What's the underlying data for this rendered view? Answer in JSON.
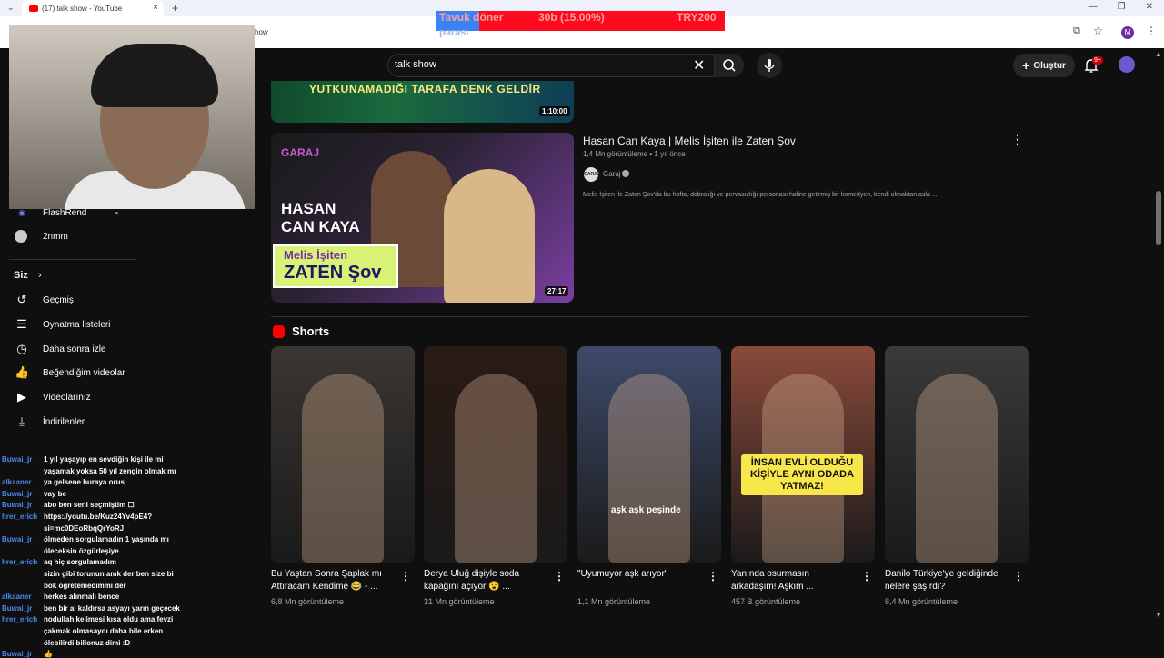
{
  "browser": {
    "tab_title": "(17) talk show - YouTube",
    "url_fragment": "how",
    "avatar_letter": "M"
  },
  "alert": {
    "left_text": "Tavuk döner",
    "middle_text": "30b (15.00%)",
    "right_text": "TRY200",
    "bottom_text": "parası"
  },
  "header": {
    "search_value": "talk show",
    "create_label": "Oluştur",
    "notifications_badge": "9+"
  },
  "sidebar": {
    "subs": [
      {
        "label": "FlashRend",
        "icon": "channel-avatar"
      },
      {
        "label": "2nmm",
        "icon": "channel-avatar"
      }
    ],
    "section_title": "Siz",
    "section_chevron": "›",
    "items": [
      {
        "label": "Geçmiş",
        "icon": "history-icon"
      },
      {
        "label": "Oynatma listeleri",
        "icon": "playlist-icon"
      },
      {
        "label": "Daha sonra izle",
        "icon": "clock-icon"
      },
      {
        "label": "Beğendiğim videolar",
        "icon": "thumbs-up-icon"
      },
      {
        "label": "Videolarınız",
        "icon": "video-icon"
      },
      {
        "label": "İndirilenler",
        "icon": "download-icon"
      }
    ]
  },
  "videos": {
    "top": {
      "thumb_text": "YUTKUNAMADIĞI TARAFA DENK GELDİR",
      "duration": "1:10:00"
    },
    "main": {
      "title": "Hasan Can Kaya | Melis İşiten ile Zaten Şov",
      "meta": "1,4 Mn görüntüleme • 1 yıl önce",
      "channel": "Garaj",
      "channel_avatar_text": "GARAJ",
      "description": "Melis İşiten ile Zaten Şov'da bu hafta, dobralığı ve pervasızlığı personası haline getirmiş bir komedyen, kendi olmaktan asla ...",
      "duration": "27:17",
      "thumb_logo": "GARAJ",
      "thumb_name_1": "HASAN",
      "thumb_name_2": "CAN KAYA",
      "thumb_show_1": "Melis İşiten",
      "thumb_show_2": "ZATEN Şov"
    }
  },
  "shorts": {
    "section_title": "Shorts",
    "items": [
      {
        "title": "Bu Yaştan Sonra Şaplak mı Attıracam Kendime 😂 - ...",
        "views": "6,8 Mn görüntüleme",
        "color": "#3a3633"
      },
      {
        "title": "Derya Uluğ dişiyle soda kapağını açıyor 😮 ...",
        "views": "31 Mn görüntüleme",
        "color": "#2a1a14"
      },
      {
        "title": "\"Uyumuyor aşk arıyor\"",
        "views": "1,1 Mn görüntüleme",
        "caption": "aşk aşk peşinde",
        "color": "#3d4a6a"
      },
      {
        "title": "Yanında osurmasın arkadaşım! Aşkım ...",
        "views": "457 B görüntüleme",
        "caption": "İNSAN EVLİ OLDUĞU KİŞİYLE AYNI ODADA YATMAZ!",
        "color": "#8a4a3a"
      },
      {
        "title": "Danilo Türkiye'ye geldiğinde nelere şaşırdı?",
        "views": "8,4 Mn görüntüleme",
        "color": "#3a3a3a"
      }
    ]
  },
  "chat": [
    {
      "user": "Buwai_jr",
      "color": "#4a8af4",
      "text": "1 yıl yaşayıp en sevdiğin kişi ile mi"
    },
    {
      "user": "",
      "color": "#ffffff",
      "text": "yaşamak yoksa 50 yıl zengin olmak mı"
    },
    {
      "user": "alkaaner",
      "color": "#4a8af4",
      "text": "ya gelsene buraya orus"
    },
    {
      "user": "Buwai_jr",
      "color": "#4a8af4",
      "text": "vay be"
    },
    {
      "user": "Buwai_jr",
      "color": "#4a8af4",
      "text": "abo ben seni seçmiştim ☐"
    },
    {
      "user": "hrer_erich",
      "color": "#4a8af4",
      "text": "https://youtu.be/Kuz24Yv4pE4?"
    },
    {
      "user": "",
      "color": "#ffffff",
      "text": "si=mc0DEoRbqQrYoRJ"
    },
    {
      "user": "Buwai_jr",
      "color": "#4a8af4",
      "text": "ölmeden sorgulamadın 1 yaşında mı"
    },
    {
      "user": "",
      "color": "#ffffff",
      "text": "öleceksin özgürleşiye"
    },
    {
      "user": "hrer_erich",
      "color": "#4a8af4",
      "text": "aq hiç sorgulamadım"
    },
    {
      "user": "",
      "color": "#ffffff",
      "text": "sizin gibi torunun amk der ben size bi"
    },
    {
      "user": "",
      "color": "#ffffff",
      "text": "bok öğretemedimmi der"
    },
    {
      "user": "alkaaner",
      "color": "#4a8af4",
      "text": "herkes alınmalı bence"
    },
    {
      "user": "Buwai_jr",
      "color": "#4a8af4",
      "text": "ben bir al kaldırsa asyayı yarın geçecek"
    },
    {
      "user": "hrer_erich",
      "color": "#4a8af4",
      "text": "nodullah kelimesi kısa oldu ama fevzi"
    },
    {
      "user": "",
      "color": "#ffffff",
      "text": "çakmak olmasaydı daha bile erken"
    },
    {
      "user": "",
      "color": "#ffffff",
      "text": "ölebilirdi billonuz dimi :D"
    },
    {
      "user": "Buwai_jr",
      "color": "#4a8af4",
      "text": "👍"
    }
  ]
}
